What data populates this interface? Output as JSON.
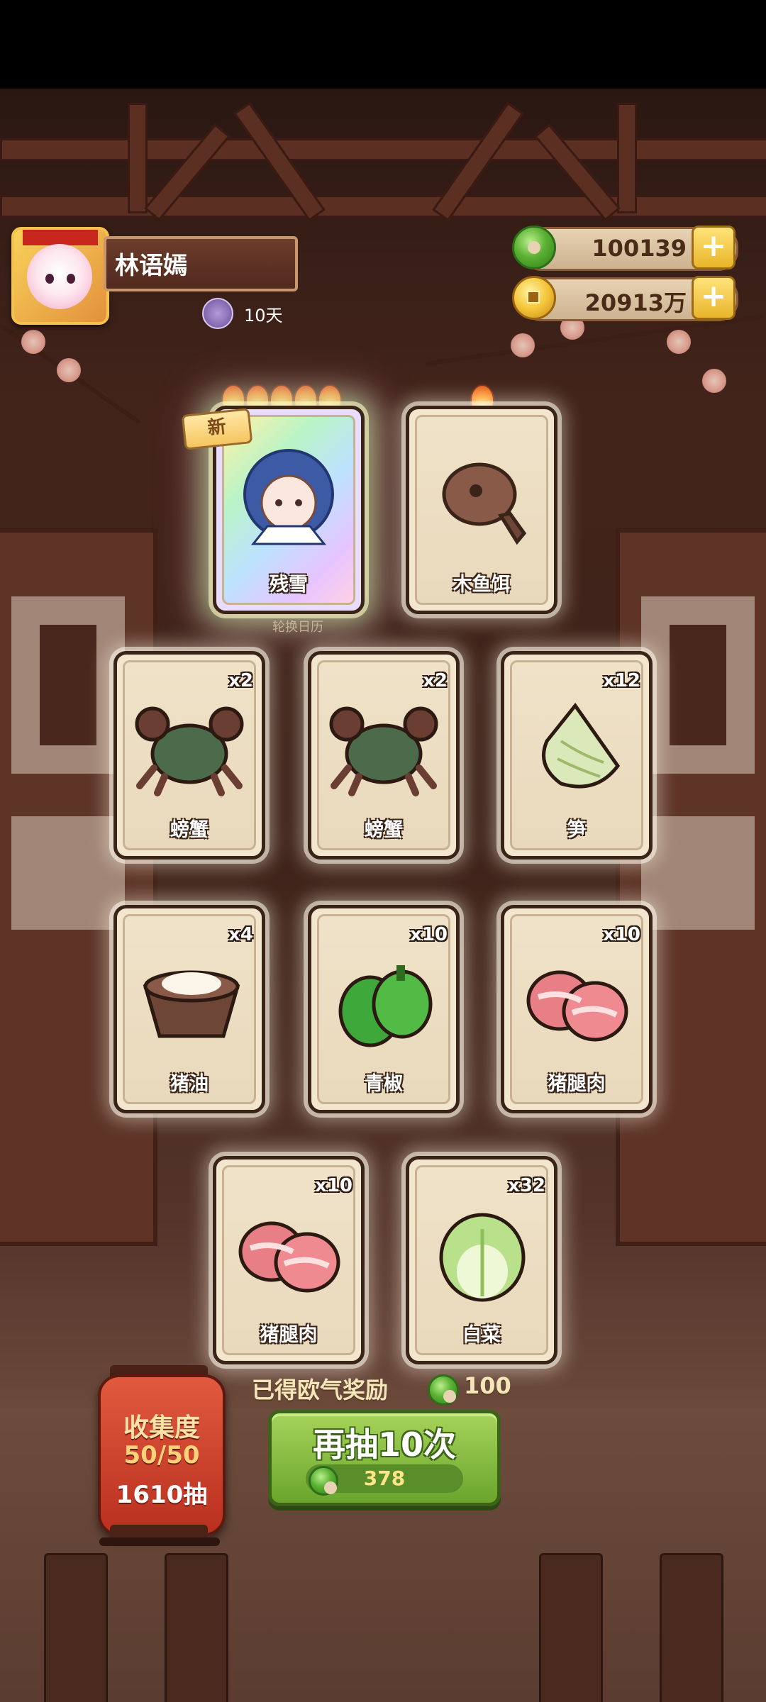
{
  "profile": {
    "name": "林语嫣",
    "days": "10天"
  },
  "currency": {
    "jade": "100139",
    "gold": "20913万"
  },
  "cards_top": [
    {
      "name": "残雪",
      "flames": 5,
      "is_new": true,
      "badge": "新"
    },
    {
      "name": "木鱼饵",
      "flames": 1
    }
  ],
  "sub_label": "轮换日历",
  "cards_grid": [
    {
      "name": "螃蟹",
      "qty": "x2"
    },
    {
      "name": "螃蟹",
      "qty": "x2"
    },
    {
      "name": "笋",
      "qty": "x12"
    },
    {
      "name": "猪油",
      "qty": "x4"
    },
    {
      "name": "青椒",
      "qty": "x10"
    },
    {
      "name": "猪腿肉",
      "qty": "x10"
    },
    {
      "name": "猪腿肉",
      "qty": "x10"
    },
    {
      "name": "白菜",
      "qty": "x32"
    }
  ],
  "reward": {
    "label": "已得欧气奖励",
    "value": "100"
  },
  "draw_button": {
    "label": "再抽10次",
    "cost": "378"
  },
  "collection": {
    "label": "收集度",
    "progress": "50/50",
    "draws": "1610抽"
  },
  "colors": {
    "accent_green": "#6aa52c",
    "card_bg": "#f3e6cf",
    "wood": "#5b2f22"
  }
}
